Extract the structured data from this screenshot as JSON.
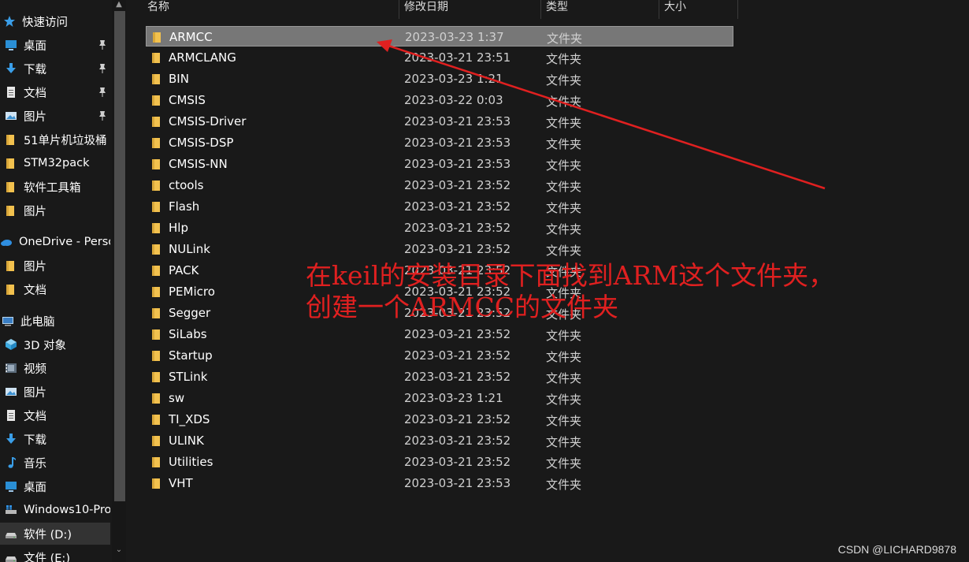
{
  "sidebar": {
    "items": [
      {
        "label": "快速访问",
        "icon": "star-icon",
        "pinned": false,
        "selected": false
      },
      {
        "label": "桌面",
        "icon": "desktop-icon",
        "pinned": true,
        "selected": false
      },
      {
        "label": "下载",
        "icon": "download-icon",
        "pinned": true,
        "selected": false
      },
      {
        "label": "文档",
        "icon": "document-icon",
        "pinned": true,
        "selected": false
      },
      {
        "label": "图片",
        "icon": "pictures-icon",
        "pinned": true,
        "selected": false
      },
      {
        "label": "51单片机垃圾桶",
        "icon": "folder-icon",
        "pinned": false,
        "selected": false
      },
      {
        "label": "STM32pack",
        "icon": "folder-icon",
        "pinned": false,
        "selected": false
      },
      {
        "label": "软件工具箱",
        "icon": "folder-icon",
        "pinned": false,
        "selected": false
      },
      {
        "label": "图片",
        "icon": "folder-icon",
        "pinned": false,
        "selected": false
      },
      {
        "label": "OneDrive - Personal",
        "icon": "cloud-icon",
        "pinned": false,
        "selected": false
      },
      {
        "label": "图片",
        "icon": "folder-icon",
        "pinned": false,
        "selected": false
      },
      {
        "label": "文档",
        "icon": "folder-icon",
        "pinned": false,
        "selected": false
      },
      {
        "label": "此电脑",
        "icon": "computer-icon",
        "pinned": false,
        "selected": false
      },
      {
        "label": "3D 对象",
        "icon": "cube-icon",
        "pinned": false,
        "selected": false
      },
      {
        "label": "视频",
        "icon": "video-icon",
        "pinned": false,
        "selected": false
      },
      {
        "label": "图片",
        "icon": "pictures-icon",
        "pinned": false,
        "selected": false
      },
      {
        "label": "文档",
        "icon": "document-icon",
        "pinned": false,
        "selected": false
      },
      {
        "label": "下载",
        "icon": "download-icon",
        "pinned": false,
        "selected": false
      },
      {
        "label": "音乐",
        "icon": "music-icon",
        "pinned": false,
        "selected": false
      },
      {
        "label": "桌面",
        "icon": "desktop-icon",
        "pinned": false,
        "selected": false
      },
      {
        "label": "Windows10-Pro",
        "icon": "drive-os-icon",
        "pinned": false,
        "selected": false
      },
      {
        "label": "软件 (D:)",
        "icon": "drive-icon",
        "pinned": false,
        "selected": true
      },
      {
        "label": "文件 (E:)",
        "icon": "drive-icon",
        "pinned": false,
        "selected": false
      }
    ]
  },
  "columns": {
    "name": "名称",
    "date": "修改日期",
    "type": "类型",
    "size": "大小"
  },
  "files": [
    {
      "name": "ARMCC",
      "date": "2023-03-23 1:37",
      "type": "文件夹",
      "selected": true
    },
    {
      "name": "ARMCLANG",
      "date": "2023-03-21 23:51",
      "type": "文件夹",
      "selected": false
    },
    {
      "name": "BIN",
      "date": "2023-03-23 1:21",
      "type": "文件夹",
      "selected": false
    },
    {
      "name": "CMSIS",
      "date": "2023-03-22 0:03",
      "type": "文件夹",
      "selected": false
    },
    {
      "name": "CMSIS-Driver",
      "date": "2023-03-21 23:53",
      "type": "文件夹",
      "selected": false
    },
    {
      "name": "CMSIS-DSP",
      "date": "2023-03-21 23:53",
      "type": "文件夹",
      "selected": false
    },
    {
      "name": "CMSIS-NN",
      "date": "2023-03-21 23:53",
      "type": "文件夹",
      "selected": false
    },
    {
      "name": "ctools",
      "date": "2023-03-21 23:52",
      "type": "文件夹",
      "selected": false
    },
    {
      "name": "Flash",
      "date": "2023-03-21 23:52",
      "type": "文件夹",
      "selected": false
    },
    {
      "name": "Hlp",
      "date": "2023-03-21 23:52",
      "type": "文件夹",
      "selected": false
    },
    {
      "name": "NULink",
      "date": "2023-03-21 23:52",
      "type": "文件夹",
      "selected": false
    },
    {
      "name": "PACK",
      "date": "2023-03-21 23:52",
      "type": "文件夹",
      "selected": false
    },
    {
      "name": "PEMicro",
      "date": "2023-03-21 23:52",
      "type": "文件夹",
      "selected": false
    },
    {
      "name": "Segger",
      "date": "2023-03-21 23:52",
      "type": "文件夹",
      "selected": false
    },
    {
      "name": "SiLabs",
      "date": "2023-03-21 23:52",
      "type": "文件夹",
      "selected": false
    },
    {
      "name": "Startup",
      "date": "2023-03-21 23:52",
      "type": "文件夹",
      "selected": false
    },
    {
      "name": "STLink",
      "date": "2023-03-21 23:52",
      "type": "文件夹",
      "selected": false
    },
    {
      "name": "sw",
      "date": "2023-03-23 1:21",
      "type": "文件夹",
      "selected": false
    },
    {
      "name": "TI_XDS",
      "date": "2023-03-21 23:52",
      "type": "文件夹",
      "selected": false
    },
    {
      "name": "ULINK",
      "date": "2023-03-21 23:52",
      "type": "文件夹",
      "selected": false
    },
    {
      "name": "Utilities",
      "date": "2023-03-21 23:52",
      "type": "文件夹",
      "selected": false
    },
    {
      "name": "VHT",
      "date": "2023-03-21 23:53",
      "type": "文件夹",
      "selected": false
    }
  ],
  "annotation": {
    "line1": "在keil的安装目录下面找到ARM这个文件夹，",
    "line2": "创建一个ARMCC的文件夹",
    "color": "#e02020"
  },
  "watermark": "CSDN @LICHARD9878",
  "colors": {
    "background": "#191919",
    "selection": "#777777",
    "folder": "#f2c14e",
    "arrow": "#e02020"
  }
}
